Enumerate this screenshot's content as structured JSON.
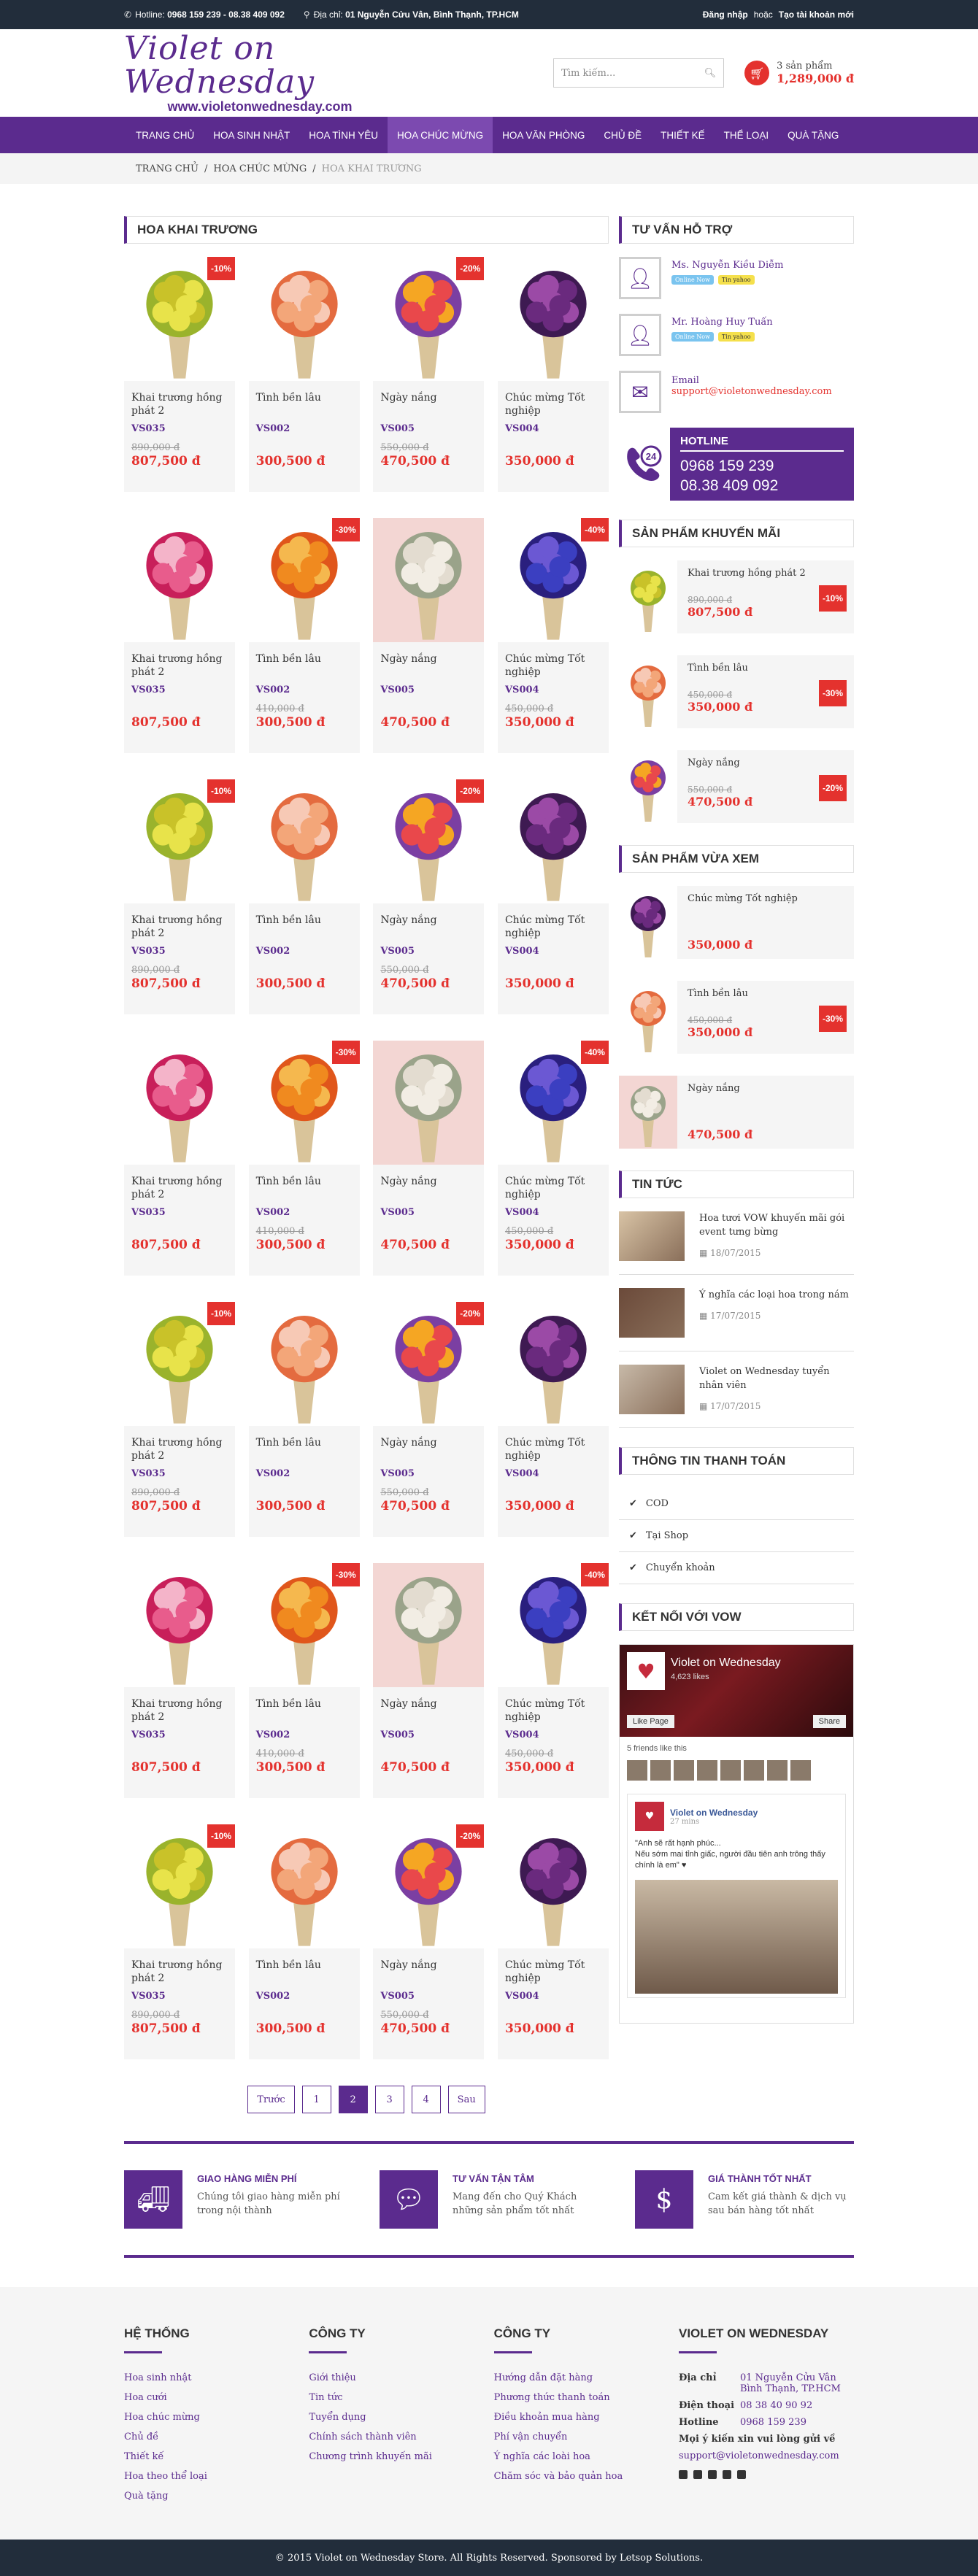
{
  "topbar": {
    "hotline_label": "Hotline:",
    "hotline_value": "0968 159 239 - 08.38 409 092",
    "address_label": "Địa chỉ:",
    "address_value": "01 Nguyễn Cửu Vân, Bình Thạnh, TP.HCM",
    "login": "Đăng nhập",
    "or": "hoặc",
    "register": "Tạo tài khoản mới"
  },
  "logo": {
    "line1": "Violet on Wednesday",
    "line2": "www.violetonwednesday.com"
  },
  "search": {
    "placeholder": "Tìm kiếm..."
  },
  "cart": {
    "count": "3 sản phẩm",
    "total": "1,289,000 đ"
  },
  "nav": [
    "TRANG CHỦ",
    "HOA SINH NHẬT",
    "HOA TÌNH YÊU",
    "HOA CHÚC MỪNG",
    "HOA VĂN PHÒNG",
    "CHỦ ĐỀ",
    "THIẾT KẾ",
    "THỂ LOẠI",
    "QUÀ TẶNG"
  ],
  "breadcrumb": [
    "TRANG CHỦ",
    "HOA CHÚC MỪNG",
    "HOA KHAI TRƯƠNG"
  ],
  "section_title": "HOA KHAI TRƯƠNG",
  "products": [
    {
      "name": "Khai trương hồng phát 2",
      "code": "VS035",
      "old": "890,000 đ",
      "price": "807,500 đ",
      "badge": "-10%",
      "img": "yellow"
    },
    {
      "name": "Tình bền lâu",
      "code": "VS002",
      "old": "",
      "price": "300,500 đ",
      "badge": "",
      "img": "peach"
    },
    {
      "name": "Ngày nắng",
      "code": "VS005",
      "old": "550,000 đ",
      "price": "470,500 đ",
      "badge": "-20%",
      "img": "mixed"
    },
    {
      "name": "Chúc mừng Tốt nghiệp",
      "code": "VS004",
      "old": "",
      "price": "350,000 đ",
      "badge": "",
      "img": "purple"
    },
    {
      "name": "Khai trương hồng phát 2",
      "code": "VS035",
      "old": "",
      "price": "807,500 đ",
      "badge": "",
      "img": "pink"
    },
    {
      "name": "Tình bền lâu",
      "code": "VS002",
      "old": "410,000 đ",
      "price": "300,500 đ",
      "badge": "-30%",
      "img": "orange"
    },
    {
      "name": "Ngày nắng",
      "code": "VS005",
      "old": "",
      "price": "470,500 đ",
      "badge": "",
      "img": "white"
    },
    {
      "name": "Chúc mừng Tốt nghiệp",
      "code": "VS004",
      "old": "450,000 đ",
      "price": "350,000 đ",
      "badge": "-40%",
      "img": "blue"
    }
  ],
  "pager": [
    "Trước",
    "1",
    "2",
    "3",
    "4",
    "Sau"
  ],
  "support": {
    "title": "TƯ VẤN HỖ TRỢ",
    "people": [
      "Ms. Nguyễn Kiều Diễm",
      "Mr. Hoàng Huy Tuấn"
    ],
    "online": "Online Now",
    "yahoo": "Tin yahoo",
    "email_label": "Email",
    "email": "support@violetonwednesday.com",
    "hotline_title": "HOTLINE",
    "hotline_24": "24",
    "phones": [
      "0968 159 239",
      "08.38 409 092"
    ]
  },
  "promo": {
    "title": "SẢN PHẨM KHUYẾN MÃI",
    "items": [
      {
        "name": "Khai trương hồng phát 2",
        "old": "890,000 đ",
        "price": "807,500 đ",
        "badge": "-10%",
        "img": "yellow"
      },
      {
        "name": "Tình bền lâu",
        "old": "450,000 đ",
        "price": "350,000 đ",
        "badge": "-30%",
        "img": "peach"
      },
      {
        "name": "Ngày nắng",
        "old": "550,000 đ",
        "price": "470,500 đ",
        "badge": "-20%",
        "img": "mixed"
      }
    ]
  },
  "viewed": {
    "title": "SẢN PHẨM VỪA XEM",
    "items": [
      {
        "name": "Chúc mừng Tốt nghiệp",
        "old": "",
        "price": "350,000 đ",
        "badge": "",
        "img": "purple"
      },
      {
        "name": "Tình bền lâu",
        "old": "450,000 đ",
        "price": "350,000 đ",
        "badge": "-30%",
        "img": "peach"
      },
      {
        "name": "Ngày nắng",
        "old": "",
        "price": "470,500 đ",
        "badge": "",
        "img": "white"
      }
    ]
  },
  "news": {
    "title": "TIN TỨC",
    "items": [
      {
        "title": "Hoa tươi VOW khuyến mãi gói event tưng bừng",
        "date": "18/07/2015"
      },
      {
        "title": "Ý nghĩa các loại hoa trong nám",
        "date": "17/07/2015"
      },
      {
        "title": "Violet on Wednesday tuyển nhân viên",
        "date": "17/07/2015"
      }
    ]
  },
  "payment": {
    "title": "THÔNG TIN THANH TOÁN",
    "items": [
      "COD",
      "Tại Shop",
      "Chuyển khoản"
    ]
  },
  "connect": {
    "title": "KẾT NỐI VỚI VOW",
    "page_name": "Violet on Wednesday",
    "likes": "4,623 likes",
    "like_btn": "Like Page",
    "share_btn": "Share",
    "friends": "5 friends like this",
    "post_name": "Violet on Wednesday",
    "post_time": "27 mins",
    "post_text": "\"Anh sẽ rất hạnh phúc...\nNếu sớm mai tỉnh giấc, người đầu tiên anh trông thấy chính là em\" ♥"
  },
  "features": [
    {
      "title": "GIAO HÀNG MIỄN PHÍ",
      "desc": "Chúng tôi giao hàng miễn phí trong nội thành",
      "icon": "truck-icon"
    },
    {
      "title": "TƯ VẤN TẬN TÂM",
      "desc": "Mang đến cho Quý Khách những sản phẩm tốt nhất",
      "icon": "chat-icon"
    },
    {
      "title": "GIÁ THÀNH TỐT NHẤT",
      "desc": "Cam kết giá thành & dịch vụ sau bán hàng tốt nhất",
      "icon": "dollar-icon"
    }
  ],
  "footer": {
    "col1": {
      "title": "HỆ THỐNG",
      "links": [
        "Hoa sinh nhật",
        "Hoa cưới",
        "Hoa chúc mừng",
        "Chủ đề",
        "Thiết kế",
        "Hoa theo thể loại",
        "Quà tặng"
      ]
    },
    "col2": {
      "title": "CÔNG TY",
      "links": [
        "Giới thiệu",
        "Tin tức",
        "Tuyển dụng",
        "Chính sách thành viên",
        "Chương trình khuyến mãi"
      ]
    },
    "col3": {
      "title": "CÔNG TY",
      "links": [
        "Hướng dẫn đặt hàng",
        "Phương thức thanh toán",
        "Điều khoản mua hàng",
        "Phí vận chuyển",
        "Ý nghĩa các loài hoa",
        "Chăm sóc và bảo quản hoa"
      ]
    },
    "col4": {
      "title": "VIOLET ON WEDNESDAY",
      "addr_label": "Địa chỉ",
      "addr": "01 Nguyễn Cửu Vân Bình Thạnh, TP.HCM",
      "phone_label": "Điện thoại",
      "phone": "08 38 40 90 92",
      "hot_label": "Hotline",
      "hot": "0968 159 239",
      "fb_label": "Mọi ý kiến xin vui lòng gửi về",
      "email": "support@violetonwednesday.com"
    }
  },
  "copyright": "© 2015 Violet on Wednesday Store. All Rights Reserved. Sponsored by Letsop Solutions.",
  "colors": {
    "brand": "#5b2b8e",
    "sale": "#e4322e",
    "dark": "#222d3b"
  }
}
